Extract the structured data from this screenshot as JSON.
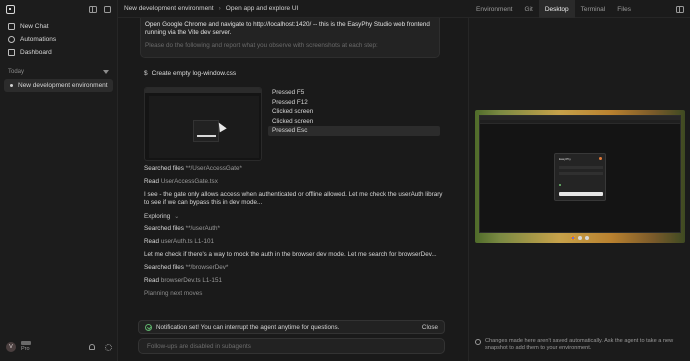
{
  "sidebar": {
    "nav": [
      {
        "label": "New Chat"
      },
      {
        "label": "Automations"
      },
      {
        "label": "Dashboard"
      }
    ],
    "section_label": "Today",
    "chats": [
      {
        "label": "New development environment"
      }
    ],
    "user": {
      "initial": "V",
      "plan": "Pro"
    }
  },
  "topbar": {
    "breadcrumb": [
      "New development environment",
      "Open app and explore UI"
    ],
    "tabs": [
      "Environment",
      "Git",
      "Desktop",
      "Terminal",
      "Files"
    ],
    "active_tab": "Desktop"
  },
  "chat": {
    "message_line1": "Open Google Chrome and navigate to http://localhost:1420/ -- this is the EasyPhy Studio web frontend running via the Vite dev server.",
    "message_line2": "Please do the following and report what you observe with screenshots at each step:",
    "command": "Create empty log-window.css",
    "actions": [
      "Pressed F5",
      "Pressed F12",
      "Clicked screen",
      "Clicked screen",
      "Pressed Esc"
    ],
    "log": {
      "search1_verb": "Searched files",
      "search1_term": "**/UserAccessGate*",
      "read1_verb": "Read",
      "read1_term": "UserAccessGate.tsx",
      "para1": "I see - the gate only allows access when authenticated or offline allowed. Let me check the userAuth library to see if we can bypass this in dev mode...",
      "exploring": "Exploring",
      "search2_verb": "Searched files",
      "search2_term": "**/userAuth*",
      "read2_verb": "Read",
      "read2_term": "userAuth.ts L1-101",
      "para2": "Let me check if there's a way to mock the auth in the browser dev mode. Let me search for browserDev...",
      "search3_verb": "Searched files",
      "search3_term": "**/browserDev*",
      "read3_verb": "Read",
      "read3_term": "browserDev.ts L1-151",
      "planning": "Planning next moves"
    },
    "notice": "Notification set! You can interrupt the agent anytime for questions.",
    "notice_close": "Close",
    "composer_placeholder": "Follow-ups are disabled in subagents"
  },
  "desktop": {
    "dialog_title": "EasyPhy",
    "note": "Changes made here aren't saved automatically. Ask the agent to take a new snapshot to add them to your environment."
  }
}
